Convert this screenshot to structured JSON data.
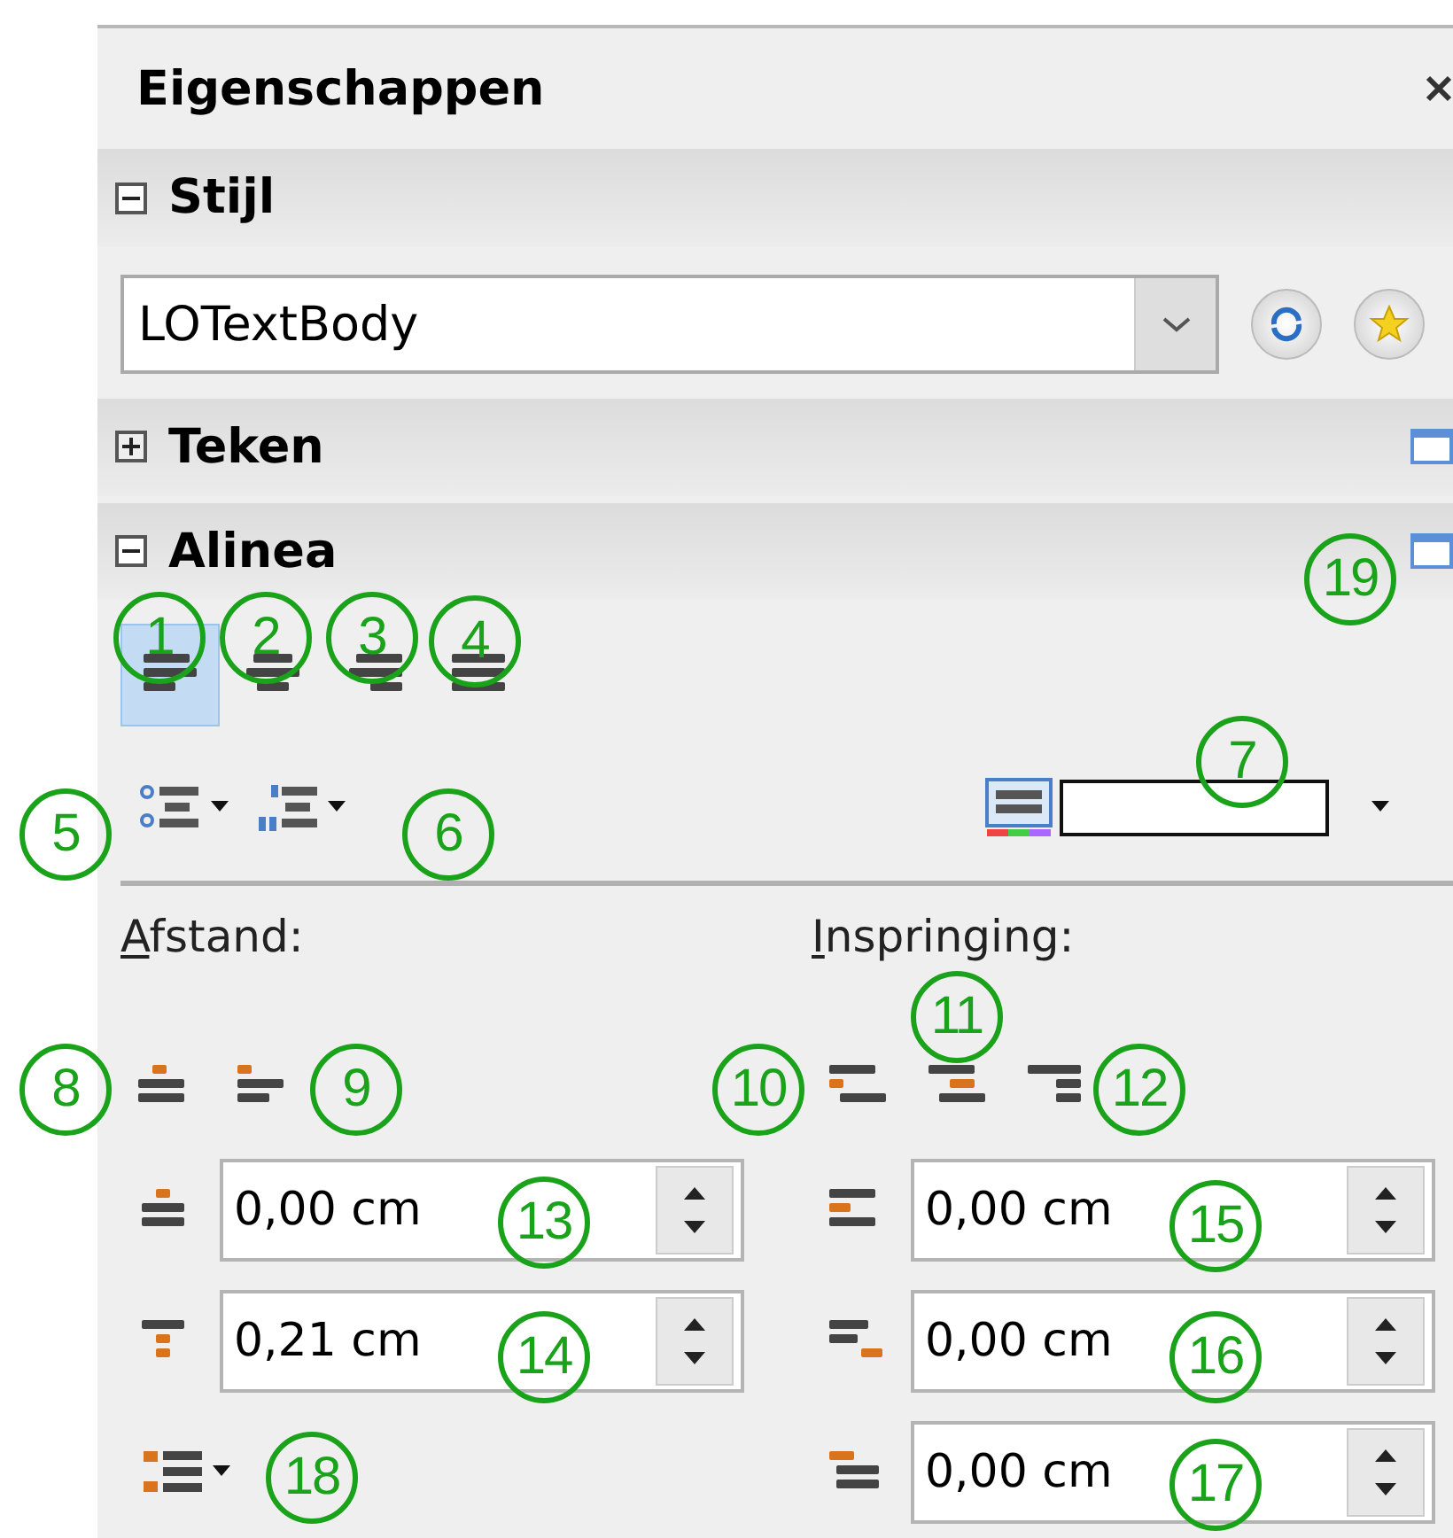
{
  "panel": {
    "title": "Eigenschappen"
  },
  "style_section": {
    "title": "Stijl",
    "expanded": true,
    "style_value": "LOTextBody"
  },
  "character_section": {
    "title": "Teken",
    "expanded": false
  },
  "paragraph_section": {
    "title": "Alinea",
    "expanded": true,
    "alignment": [
      {
        "kind": "left",
        "selected": true
      },
      {
        "kind": "center",
        "selected": false
      },
      {
        "kind": "right",
        "selected": false
      },
      {
        "kind": "justify",
        "selected": false
      }
    ],
    "spacing_label": "Afstand:",
    "indent_label": "Inspringing:",
    "spacing_fields": [
      {
        "kind": "above",
        "value": "0,00 cm"
      },
      {
        "kind": "below",
        "value": "0,21 cm"
      }
    ],
    "indent_fields": [
      {
        "kind": "before",
        "value": "0,00 cm"
      },
      {
        "kind": "after",
        "value": "0,00 cm"
      },
      {
        "kind": "first",
        "value": "0,00 cm"
      }
    ]
  },
  "callouts": [
    "1",
    "2",
    "3",
    "4",
    "5",
    "6",
    "7",
    "8",
    "9",
    "10",
    "11",
    "12",
    "13",
    "14",
    "15",
    "16",
    "17",
    "18",
    "19"
  ]
}
